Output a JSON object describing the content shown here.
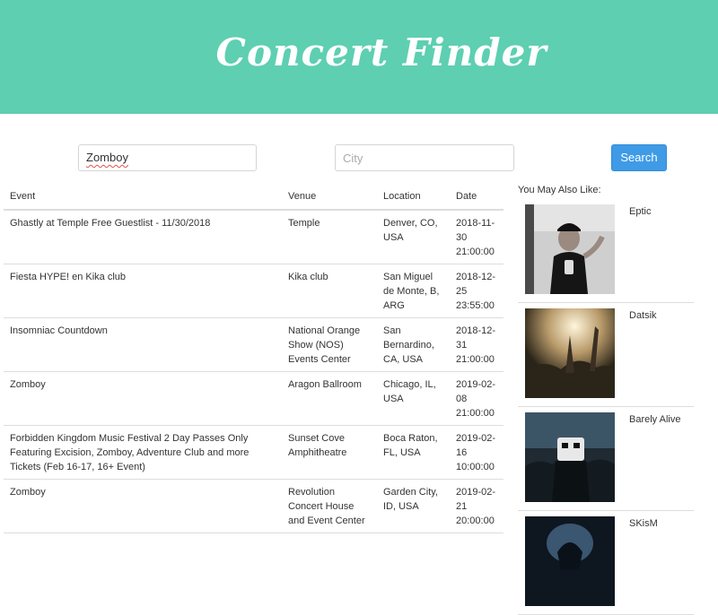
{
  "header": {
    "title": "Concert Finder"
  },
  "search": {
    "artist_value": "Zomboy",
    "city_placeholder": "City",
    "button_label": "Search"
  },
  "table": {
    "columns": [
      "Event",
      "Venue",
      "Location",
      "Date"
    ],
    "rows": [
      {
        "event": "Ghastly at Temple Free Guestlist - 11/30/2018",
        "venue": "Temple",
        "location": "Denver, CO, USA",
        "date": "2018-11-30 21:00:00"
      },
      {
        "event": "Fiesta HYPE! en Kika club",
        "venue": "Kika club",
        "location": "San Miguel de Monte, B, ARG",
        "date": "2018-12-25 23:55:00"
      },
      {
        "event": "Insomniac Countdown",
        "venue": "National Orange Show (NOS) Events Center",
        "location": "San Bernardino, CA, USA",
        "date": "2018-12-31 21:00:00"
      },
      {
        "event": "Zomboy",
        "venue": "Aragon Ballroom",
        "location": "Chicago, IL, USA",
        "date": "2019-02-08 21:00:00"
      },
      {
        "event": "Forbidden Kingdom Music Festival 2 Day Passes Only Featuring Excision, Zomboy, Adventure Club and more Tickets (Feb 16-17, 16+ Event)",
        "venue": "Sunset Cove Amphitheatre",
        "location": "Boca Raton, FL, USA",
        "date": "2019-02-16 10:00:00"
      },
      {
        "event": "Zomboy",
        "venue": "Revolution Concert House and Event Center",
        "location": "Garden City, ID, USA",
        "date": "2019-02-21 20:00:00"
      }
    ]
  },
  "recommendations": {
    "heading": "You May Also Like:",
    "artists": [
      {
        "name": "Eptic"
      },
      {
        "name": "Datsik"
      },
      {
        "name": "Barely Alive"
      },
      {
        "name": "SKisM"
      }
    ]
  }
}
